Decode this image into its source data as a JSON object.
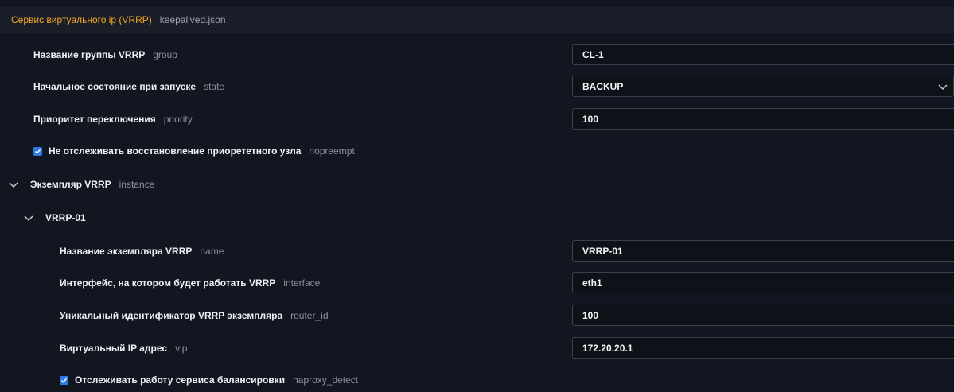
{
  "header": {
    "title": "Сервис виртуального ip (VRRP)",
    "file": "keepalived.json"
  },
  "group": {
    "label": "Название группы VRRP",
    "key": "group",
    "value": "CL-1"
  },
  "state": {
    "label": "Начальное состояние при запуске",
    "key": "state",
    "value": "BACKUP"
  },
  "priority": {
    "label": "Приоритет переключения",
    "key": "priority",
    "value": "100"
  },
  "nopreempt": {
    "label": "Не отслеживать восстановление приорететного узла",
    "key": "nopreempt",
    "checked": true
  },
  "instance": {
    "label": "Экземпляр VRRP",
    "key": "instance",
    "expanded": true
  },
  "vrrp01": {
    "title": "VRRP-01",
    "name": {
      "label": "Название экземпляра VRRP",
      "key": "name",
      "value": "VRRP-01"
    },
    "interface": {
      "label": "Интерфейс, на котором будет работать VRRP",
      "key": "interface",
      "value": "eth1"
    },
    "router_id": {
      "label": "Уникальный идентификатор VRRP экземпляра",
      "key": "router_id",
      "value": "100"
    },
    "vip": {
      "label": "Виртуальный IP адрес",
      "key": "vip",
      "value": "172.20.20.1"
    },
    "haproxy_detect": {
      "label": "Отслеживать работу сервиса балансировки",
      "key": "haproxy_detect",
      "checked": true
    }
  },
  "colors": {
    "accent": "#f5a623",
    "checkbox": "#2e7ae6",
    "background": "#121620"
  }
}
